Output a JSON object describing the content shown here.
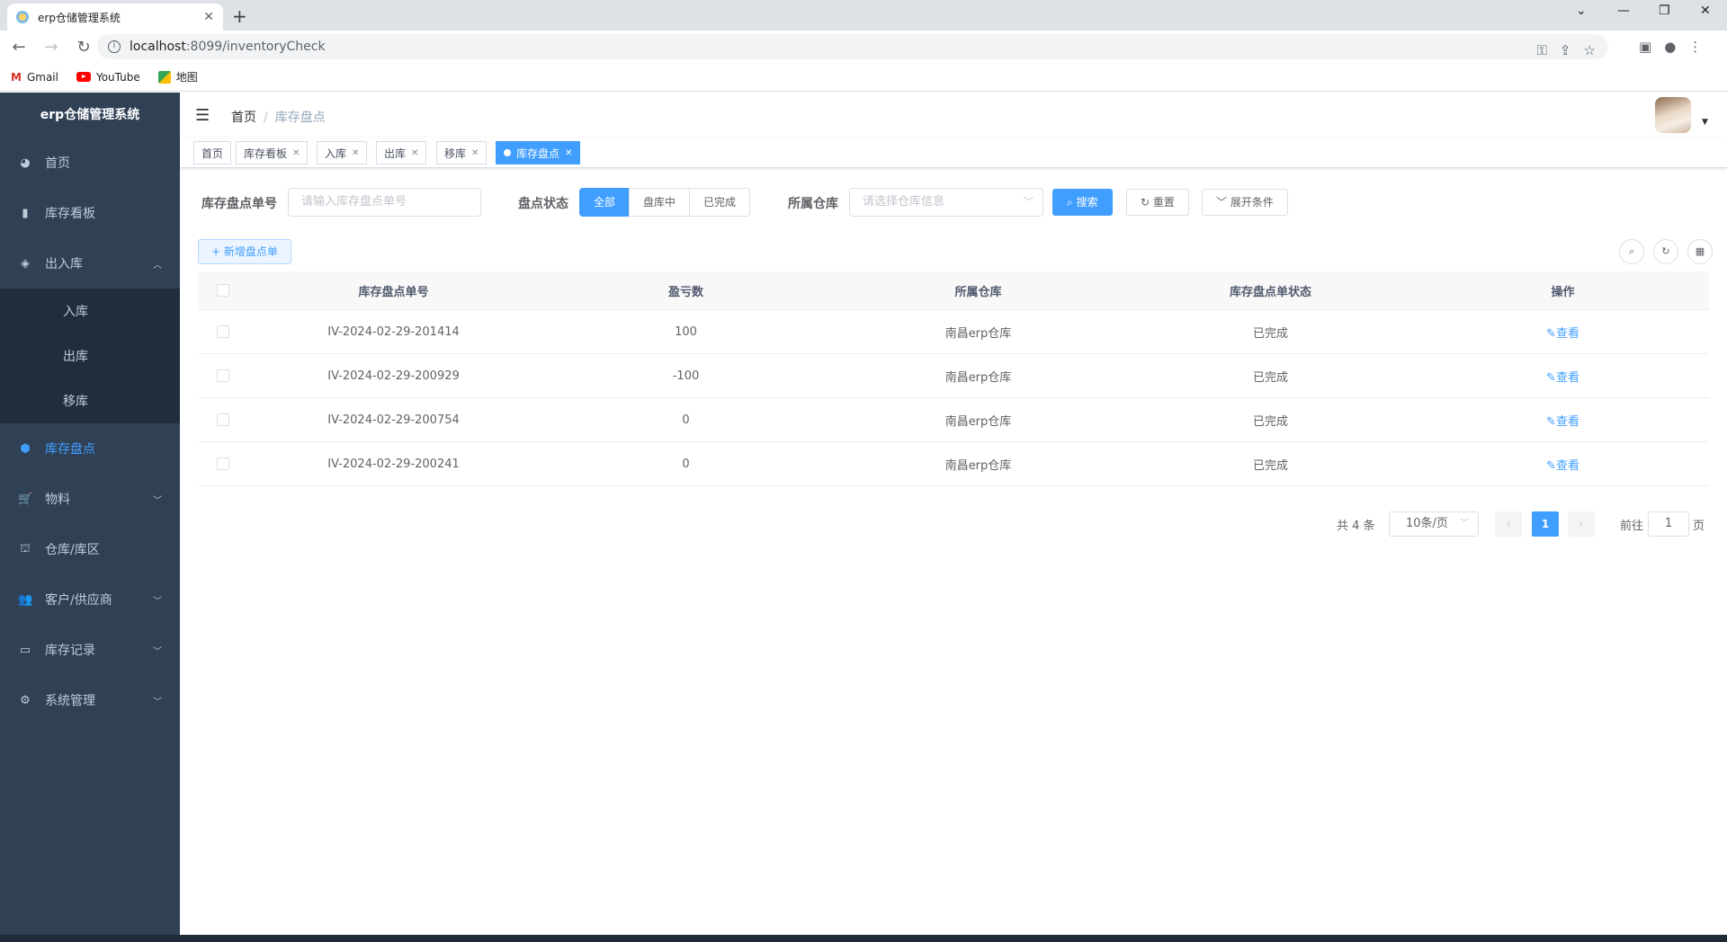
{
  "browser": {
    "tab_title": "erp仓储管理系统",
    "url_host": "localhost",
    "url_path": ":8099/inventoryCheck",
    "bookmarks": [
      "Gmail",
      "YouTube",
      "地图"
    ]
  },
  "sidebar": {
    "logo": "erp仓储管理系统",
    "items": [
      {
        "label": "首页",
        "icon": "dashboard-icon"
      },
      {
        "label": "库存看板",
        "icon": "bar-chart-icon"
      },
      {
        "label": "出入库",
        "icon": "layers-icon",
        "expanded": true
      },
      {
        "label": "入库"
      },
      {
        "label": "出库"
      },
      {
        "label": "移库"
      },
      {
        "label": "库存盘点",
        "icon": "check-icon",
        "active": true
      },
      {
        "label": "物料",
        "icon": "cart-icon"
      },
      {
        "label": "仓库/库区",
        "icon": "warehouse-icon"
      },
      {
        "label": "客户/供应商",
        "icon": "users-icon"
      },
      {
        "label": "库存记录",
        "icon": "monitor-icon"
      },
      {
        "label": "系统管理",
        "icon": "gear-icon"
      }
    ]
  },
  "navbar": {
    "breadcrumb_home": "首页",
    "breadcrumb_sep": "/",
    "breadcrumb_current": "库存盘点"
  },
  "tags": [
    {
      "label": "首页",
      "closable": false
    },
    {
      "label": "库存看板",
      "closable": true
    },
    {
      "label": "入库",
      "closable": true
    },
    {
      "label": "出库",
      "closable": true
    },
    {
      "label": "移库",
      "closable": true
    },
    {
      "label": "库存盘点",
      "closable": true,
      "active": true
    }
  ],
  "search": {
    "no_label": "库存盘点单号",
    "no_placeholder": "请输入库存盘点单号",
    "status_label": "盘点状态",
    "status_options": [
      "全部",
      "盘库中",
      "已完成"
    ],
    "status_selected": "全部",
    "warehouse_label": "所属仓库",
    "warehouse_placeholder": "请选择仓库信息",
    "search_btn": "搜索",
    "reset_btn": "重置",
    "expand_btn": "展开条件"
  },
  "toolbar": {
    "add_btn": "新增盘点单"
  },
  "table": {
    "headers": [
      "库存盘点单号",
      "盈亏数",
      "所属仓库",
      "库存盘点单状态",
      "操作"
    ],
    "rows": [
      {
        "no": "IV-2024-02-29-201414",
        "diff": "100",
        "warehouse": "南昌erp仓库",
        "status": "已完成",
        "action": "查看"
      },
      {
        "no": "IV-2024-02-29-200929",
        "diff": "-100",
        "warehouse": "南昌erp仓库",
        "status": "已完成",
        "action": "查看"
      },
      {
        "no": "IV-2024-02-29-200754",
        "diff": "0",
        "warehouse": "南昌erp仓库",
        "status": "已完成",
        "action": "查看"
      },
      {
        "no": "IV-2024-02-29-200241",
        "diff": "0",
        "warehouse": "南昌erp仓库",
        "status": "已完成",
        "action": "查看"
      }
    ]
  },
  "pagination": {
    "total": "共 4 条",
    "page_size": "10条/页",
    "current_page": "1",
    "goto_prefix": "前往",
    "goto_value": "1",
    "goto_suffix": "页"
  },
  "colors": {
    "primary": "#409eff",
    "sidebar_bg": "#304156",
    "submenu_bg": "#1f2d3d"
  }
}
